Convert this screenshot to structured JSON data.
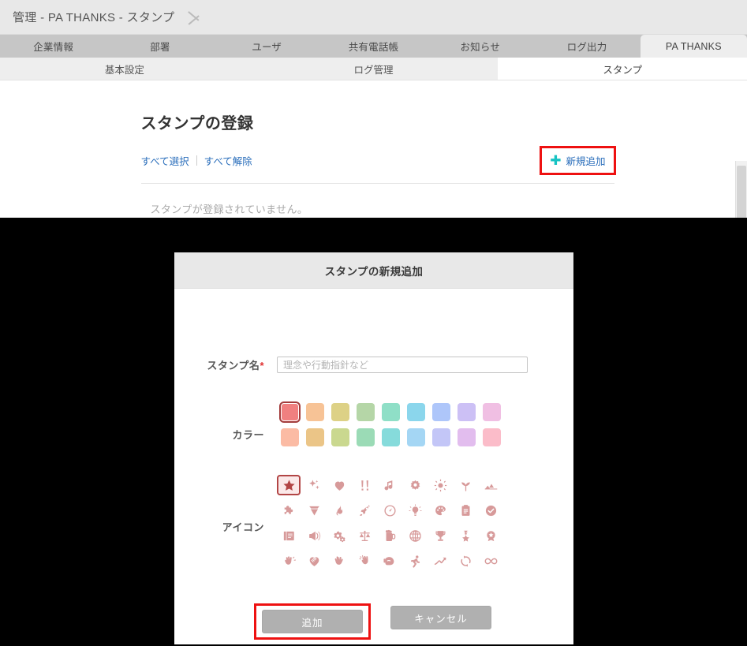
{
  "breadcrumb": {
    "text": "管理 - PA THANKS - スタンプ"
  },
  "main_tabs": [
    {
      "label": "企業情報",
      "active": false
    },
    {
      "label": "部署",
      "active": false
    },
    {
      "label": "ユーザ",
      "active": false
    },
    {
      "label": "共有電話帳",
      "active": false
    },
    {
      "label": "お知らせ",
      "active": false
    },
    {
      "label": "ログ出力",
      "active": false
    },
    {
      "label": "PA THANKS",
      "active": true
    }
  ],
  "sub_tabs": [
    {
      "label": "基本設定",
      "active": false
    },
    {
      "label": "ログ管理",
      "active": false
    },
    {
      "label": "スタンプ",
      "active": true
    }
  ],
  "page": {
    "title": "スタンプの登録",
    "select_all": "すべて選択",
    "deselect_all": "すべて解除",
    "add_new": "新規追加",
    "add_new_icon": "plus-icon",
    "empty_message": "スタンプが登録されていません。"
  },
  "modal": {
    "title": "スタンプの新規追加",
    "fields": {
      "name_label": "スタンプ名",
      "name_required_mark": "*",
      "name_value": "",
      "name_placeholder": "理念や行動指針など",
      "color_label": "カラー",
      "icon_label": "アイコン"
    },
    "colors": {
      "row1": [
        "#f08080",
        "#f7c396",
        "#ddd186",
        "#b5d6a7",
        "#8fdfc7",
        "#8bd6ec",
        "#aec6fa",
        "#ccc0f5",
        "#f0bfe3"
      ],
      "row2": [
        "#fbbba4",
        "#ebc587",
        "#cad88f",
        "#9bdbb6",
        "#86dbdb",
        "#a4d6f4",
        "#c3c6f7",
        "#e2bdee",
        "#fbbcc9"
      ],
      "selected_index": 0,
      "selected_value": "#f08080",
      "selection_border": "#a33b3b"
    },
    "icon_color": "#d79a9a",
    "icons": [
      "star-icon",
      "sparkles-icon",
      "heart-icon",
      "double-exclamation-icon",
      "music-note-icon",
      "flower-icon",
      "sun-icon",
      "sprout-icon",
      "mountain-icon",
      "puzzle-piece-icon",
      "diamond-icon",
      "fire-icon",
      "rocket-icon",
      "gauge-icon",
      "lightbulb-icon",
      "palette-icon",
      "clipboard-icon",
      "check-circle-icon",
      "book-icon",
      "megaphone-icon",
      "gears-icon",
      "scales-icon",
      "beer-mug-icon",
      "globe-icon",
      "trophy-icon",
      "medal-icon",
      "award-badge-icon",
      "raised-hands-icon",
      "handshake-heart-icon",
      "victory-hand-icon",
      "clapping-hands-icon",
      "flexed-bicep-icon",
      "running-person-icon",
      "chart-line-up-icon",
      "refresh-cycle-icon",
      "infinity-icon"
    ],
    "selected_icon": "star-icon",
    "selected_icon_index": 0,
    "buttons": {
      "submit": "追加",
      "cancel": "キャンセル"
    }
  },
  "annotations": {
    "highlight_color": "#ee1111",
    "highlighted": [
      "新規追加",
      "追加"
    ]
  }
}
